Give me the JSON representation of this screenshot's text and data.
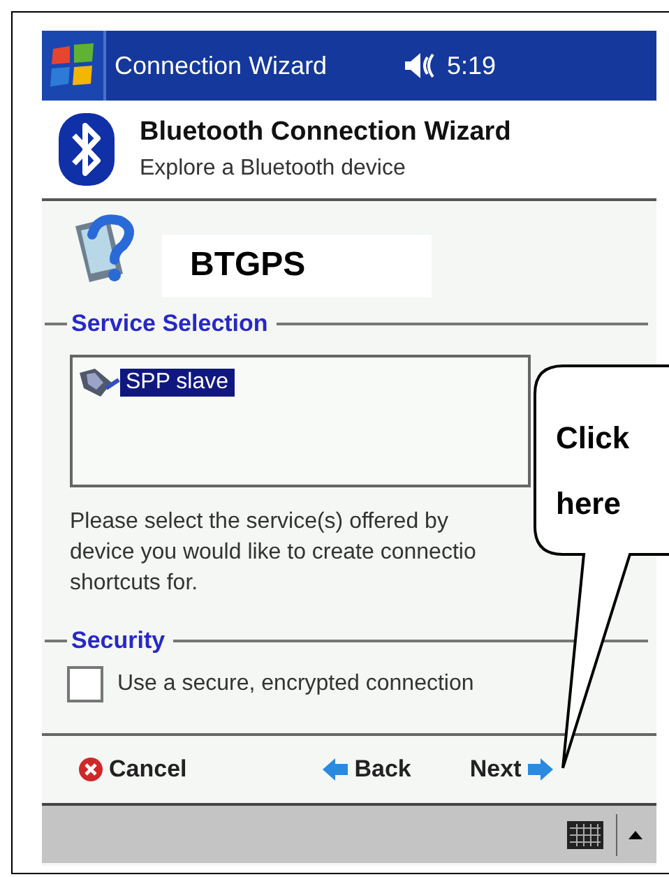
{
  "title_bar": {
    "title": "Connection Wizard",
    "time": "5:19"
  },
  "header": {
    "title": "Bluetooth Connection Wizard",
    "subtitle": "Explore a Bluetooth device"
  },
  "device": {
    "name": "BTGPS"
  },
  "service_selection": {
    "label": "Service Selection",
    "items": [
      {
        "name": "SPP slave",
        "selected": true
      }
    ],
    "help_lines": [
      "Please select the service(s) offered by",
      "device you would like to create connectio",
      "shortcuts for."
    ]
  },
  "security": {
    "label": "Security",
    "options": [
      {
        "label": "Use a secure, encrypted connection",
        "checked": false
      }
    ]
  },
  "buttons": [
    {
      "kind": "cancel",
      "label": "Cancel"
    },
    {
      "kind": "back",
      "label": "Back"
    },
    {
      "kind": "next",
      "label": "Next"
    }
  ],
  "callout": {
    "text": "Click here"
  }
}
